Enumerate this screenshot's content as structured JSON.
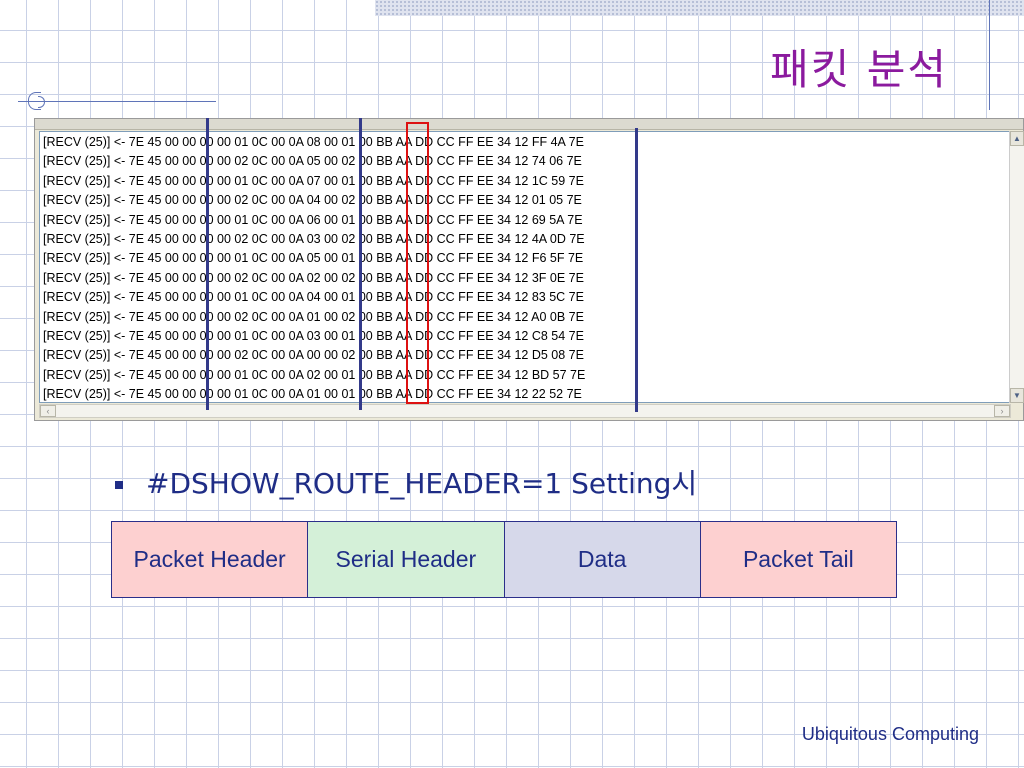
{
  "title": "패킷 분석",
  "log": {
    "lines": [
      "[RECV (25)] <- 7E 45 00 00 00 00 01 0C 00 0A 08 00 01 00 BB AA DD CC FF EE 34 12 FF 4A 7E",
      "[RECV (25)] <- 7E 45 00 00 00 00 02 0C 00 0A 05 00 02 00 BB AA DD CC FF EE 34 12 74 06 7E",
      "[RECV (25)] <- 7E 45 00 00 00 00 01 0C 00 0A 07 00 01 00 BB AA DD CC FF EE 34 12 1C 59 7E",
      "[RECV (25)] <- 7E 45 00 00 00 00 02 0C 00 0A 04 00 02 00 BB AA DD CC FF EE 34 12 01 05 7E",
      "[RECV (25)] <- 7E 45 00 00 00 00 01 0C 00 0A 06 00 01 00 BB AA DD CC FF EE 34 12 69 5A 7E",
      "[RECV (25)] <- 7E 45 00 00 00 00 02 0C 00 0A 03 00 02 00 BB AA DD CC FF EE 34 12 4A 0D 7E",
      "[RECV (25)] <- 7E 45 00 00 00 00 01 0C 00 0A 05 00 01 00 BB AA DD CC FF EE 34 12 F6 5F 7E",
      "[RECV (25)] <- 7E 45 00 00 00 00 02 0C 00 0A 02 00 02 00 BB AA DD CC FF EE 34 12 3F 0E 7E",
      "[RECV (25)] <- 7E 45 00 00 00 00 01 0C 00 0A 04 00 01 00 BB AA DD CC FF EE 34 12 83 5C 7E",
      "[RECV (25)] <- 7E 45 00 00 00 00 02 0C 00 0A 01 00 02 00 BB AA DD CC FF EE 34 12 A0 0B 7E",
      "[RECV (25)] <- 7E 45 00 00 00 00 01 0C 00 0A 03 00 01 00 BB AA DD CC FF EE 34 12 C8 54 7E",
      "[RECV (25)] <- 7E 45 00 00 00 00 02 0C 00 0A 00 00 02 00 BB AA DD CC FF EE 34 12 D5 08 7E",
      "[RECV (25)] <- 7E 45 00 00 00 00 01 0C 00 0A 02 00 01 00 BB AA DD CC FF EE 34 12 BD 57 7E",
      "[RECV (25)] <- 7E 45 00 00 00 00 01 0C 00 0A 01 00 01 00 BB AA DD CC FF EE 34 12 22 52 7E"
    ]
  },
  "bullet": {
    "text": "#DSHOW_ROUTE_HEADER=1 Setting시"
  },
  "packet_table": {
    "cells": [
      {
        "label": "Packet Header",
        "color": "#fdd0d0"
      },
      {
        "label": "Serial Header",
        "color": "#d4f0d8"
      },
      {
        "label": "Data",
        "color": "#d6d8ea"
      },
      {
        "label": "Packet Tail",
        "color": "#fdd0d0"
      }
    ]
  },
  "footer": {
    "text": "Ubiquitous Computing"
  },
  "colors": {
    "accent": "#1f2d86",
    "title": "#8b1a9e",
    "marker": "#333a8a",
    "highlight": "#dd1111"
  }
}
